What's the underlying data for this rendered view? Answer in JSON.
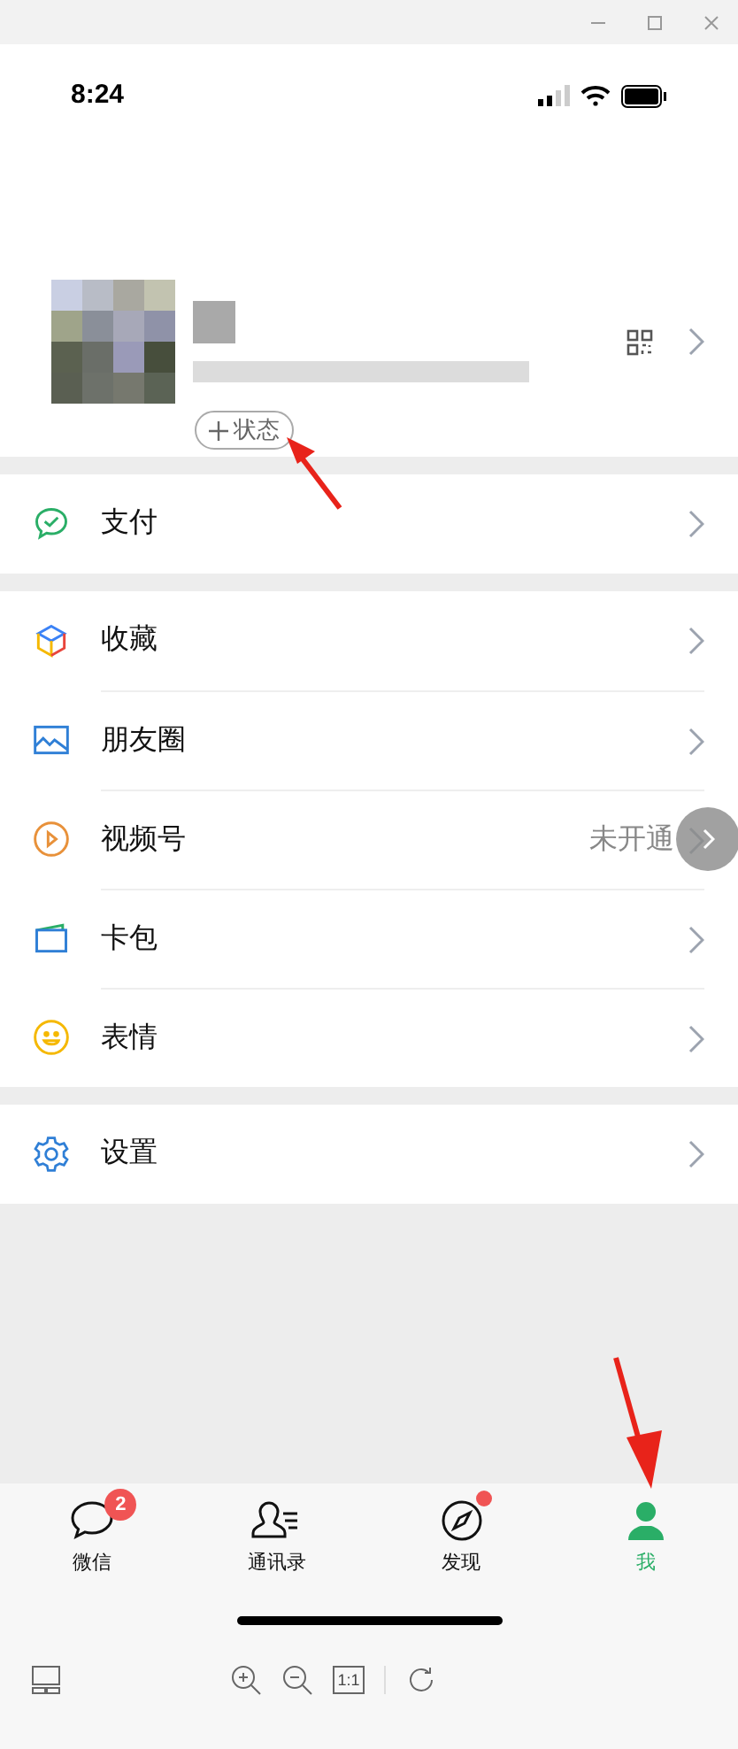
{
  "status_bar": {
    "time": "8:24"
  },
  "profile": {
    "status_button": "状态"
  },
  "menu_groups": [
    {
      "items": [
        {
          "kind": "pay",
          "label": "支付"
        }
      ]
    },
    {
      "items": [
        {
          "kind": "favorites",
          "label": "收藏"
        },
        {
          "kind": "moments",
          "label": "朋友圈"
        },
        {
          "kind": "channels",
          "label": "视频号",
          "value": "未开通"
        },
        {
          "kind": "cards",
          "label": "卡包"
        },
        {
          "kind": "stickers",
          "label": "表情"
        }
      ]
    },
    {
      "items": [
        {
          "kind": "settings",
          "label": "设置"
        }
      ]
    }
  ],
  "tabs": [
    {
      "kind": "chats",
      "label": "微信",
      "badge": "2",
      "dot": false,
      "selected": false
    },
    {
      "kind": "contacts",
      "label": "通讯录",
      "dot": false,
      "selected": false
    },
    {
      "kind": "discover",
      "label": "发现",
      "dot": true,
      "selected": false
    },
    {
      "kind": "me",
      "label": "我",
      "dot": false,
      "selected": true
    }
  ],
  "toolbar": {
    "actual_size": "1:1"
  }
}
